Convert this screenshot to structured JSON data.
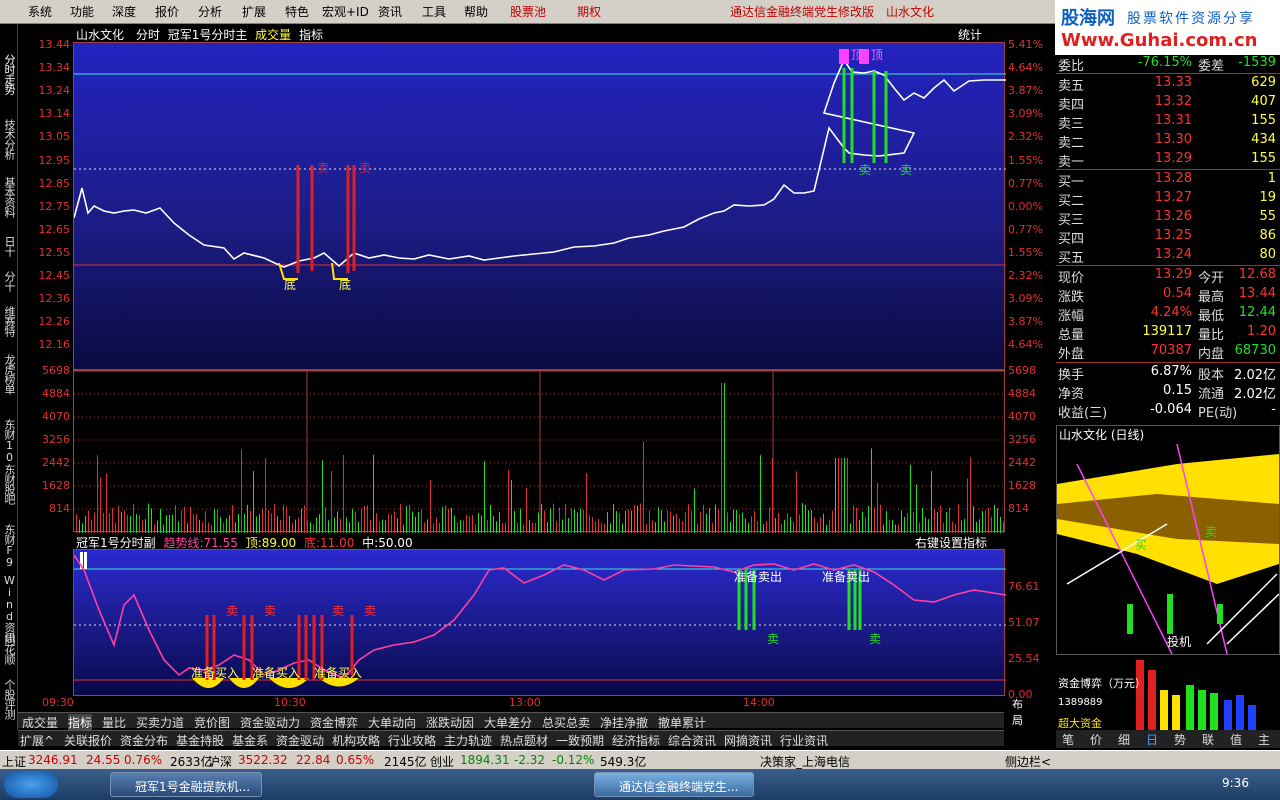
{
  "menu": {
    "items": [
      "系统",
      "功能",
      "深度",
      "报价",
      "分析",
      "扩展",
      "特色",
      "宏观+ID",
      "资讯",
      "工具",
      "帮助",
      "股票池",
      "期权"
    ],
    "title": "通达信金融终端党生修改版",
    "stock": "山水文化"
  },
  "logo": {
    "line1": "股海网",
    "line2": "股票软件资源分享",
    "url": "Www.Guhai.com.cn"
  },
  "leftbar": {
    "items": [
      "分时走势",
      "技术分析",
      "基本资料",
      "日十",
      "分十",
      "维赛特",
      "龙虎榜单",
      "东财10",
      "东财股吧",
      "东财F9",
      "Wind资讯",
      "同花顺",
      "个股评测"
    ]
  },
  "main": {
    "stock": "山水文化",
    "mode": "分时",
    "indicator": "冠军1号分时主",
    "vol": "成交量",
    "ind": "指标",
    "stat": "统计",
    "left_axis": [
      "13.44",
      "13.34",
      "13.24",
      "13.14",
      "13.05",
      "12.95",
      "12.85",
      "12.75",
      "12.65",
      "12.55",
      "12.45",
      "12.36",
      "12.26",
      "12.16"
    ],
    "right_axis": [
      "5.41%",
      "4.64%",
      "3.87%",
      "3.09%",
      "2.32%",
      "1.55%",
      "0.77%",
      "0.00%",
      "0.77%",
      "1.55%",
      "2.32%",
      "3.09%",
      "3.87%",
      "4.64%"
    ],
    "labels": {
      "bottom": "底",
      "top": "顶",
      "sell": "卖"
    }
  },
  "vol": {
    "axis": [
      "5698",
      "4884",
      "4070",
      "3256",
      "2442",
      "1628",
      "814"
    ]
  },
  "sub": {
    "title": "冠军1号分时副",
    "trend_label": "趋势线:",
    "trend_val": "71.55",
    "top_label": "顶:",
    "top_val": "89.00",
    "bot_label": "底:",
    "bot_val": "11.00",
    "mid_label": "中:",
    "mid_val": "50.00",
    "right_hint": "右键设置指标",
    "right_axis": [
      "76.61",
      "51.07",
      "25.54",
      "0.00"
    ],
    "buy": "准备买入",
    "sellprep": "准备卖出",
    "sell": "卖"
  },
  "time": {
    "labels": [
      "09:30",
      "10:30",
      "13:00",
      "14:00"
    ],
    "layout": "布局"
  },
  "tabs1": [
    "成交量",
    "指标",
    "量比",
    "买卖力道",
    "竞价图",
    "资金驱动力",
    "资金博弈",
    "大单动向",
    "涨跌动因",
    "大单差分",
    "总买总卖",
    "净挂净撤",
    "撤单累计"
  ],
  "tabs2": [
    "扩展^",
    "关联报价",
    "资金分布",
    "基金持股",
    "基金系",
    "资金驱动",
    "机构攻略",
    "行业攻略",
    "主力轨迹",
    "热点题材",
    "一致预期",
    "经济指标",
    "综合资讯",
    "网摘资讯",
    "行业资讯"
  ],
  "quote": {
    "wb": [
      "委比",
      "-76.15%",
      "委差",
      "-1539"
    ],
    "sells": [
      [
        "卖五",
        "13.33",
        "629"
      ],
      [
        "卖四",
        "13.32",
        "407"
      ],
      [
        "卖三",
        "13.31",
        "155"
      ],
      [
        "卖二",
        "13.30",
        "434"
      ],
      [
        "卖一",
        "13.29",
        "155"
      ]
    ],
    "buys": [
      [
        "买一",
        "13.28",
        "1"
      ],
      [
        "买二",
        "13.27",
        "19"
      ],
      [
        "买三",
        "13.26",
        "55"
      ],
      [
        "买四",
        "13.25",
        "86"
      ],
      [
        "买五",
        "13.24",
        "80"
      ]
    ],
    "stats": [
      [
        "现价",
        "13.29",
        "今开",
        "12.68"
      ],
      [
        "涨跌",
        "0.54",
        "最高",
        "13.44"
      ],
      [
        "涨幅",
        "4.24%",
        "最低",
        "12.44"
      ],
      [
        "总量",
        "139117",
        "量比",
        "1.20"
      ],
      [
        "外盘",
        "70387",
        "内盘",
        "68730"
      ]
    ],
    "stats2": [
      [
        "换手",
        "6.87%",
        "股本",
        "2.02亿"
      ],
      [
        "净资",
        "0.15",
        "流通",
        "2.02亿"
      ],
      [
        "收益(三)",
        "-0.064",
        "PE(动)",
        "-"
      ]
    ]
  },
  "daily": {
    "title": "山水文化 (日线)",
    "buy": "买",
    "sell": "卖",
    "invest": "投机"
  },
  "fund": {
    "title": "资金博弈（万元）",
    "v1": "1389889",
    "v2": "超大资金"
  },
  "bottomtabs": [
    "笔",
    "价",
    "细",
    "日",
    "势",
    "联",
    "值",
    "主"
  ],
  "status": {
    "sh_label": "上证",
    "sh": "3246.91",
    "sh_chg": "24.55",
    "sh_pct": "0.76%",
    "sh_amt": "2633亿",
    "hs_label": "沪深",
    "hs": "3522.32",
    "hs_chg": "22.84",
    "hs_pct": "0.65%",
    "hs_amt": "2145亿",
    "cy_label": "创业",
    "cy": "1894.31",
    "cy_chg": "-2.32",
    "cy_pct": "-0.12%",
    "cy_amt": "549.3亿",
    "news": "决策家_上海电信",
    "side": "侧边栏<"
  },
  "taskbar": {
    "win1": "冠军1号金融提款机...",
    "win2": "通达信金融终端党生...",
    "clock": "9:36"
  }
}
